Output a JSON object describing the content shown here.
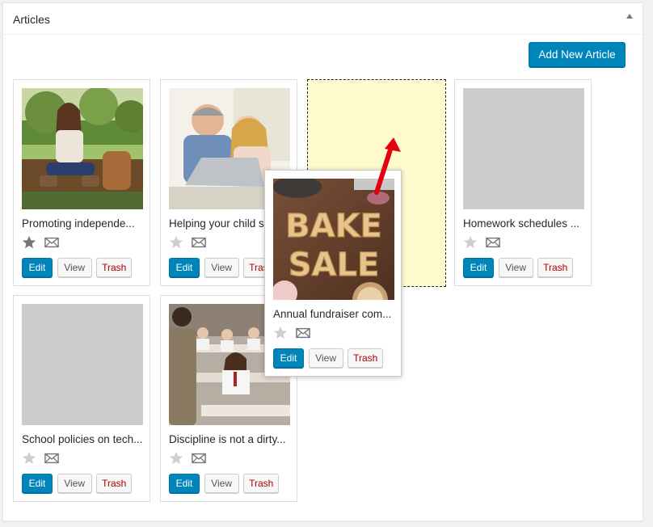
{
  "panel": {
    "title": "Articles",
    "toggle_icon": "arrow-up-icon",
    "add_button_label": "Add New Article"
  },
  "colors": {
    "primary": "#0085ba",
    "trash": "#aa0000",
    "placeholder": "#fffacd",
    "drag_arrow": "#e3000f"
  },
  "cards": [
    {
      "title": "Promoting independe...",
      "featured": true,
      "image": "girl-on-bench-photo",
      "edit": "Edit",
      "view": "View",
      "trash": "Trash"
    },
    {
      "title": "Helping your child s",
      "featured": false,
      "image": "parent-and-child-laptop-photo",
      "edit": "Edit",
      "view": "View",
      "trash": "Trash"
    },
    {
      "title": "Homework schedules ...",
      "featured": false,
      "image": "placeholder-image",
      "edit": "Edit",
      "view": "View",
      "trash": "Trash"
    },
    {
      "title": "School policies on tech...",
      "featured": false,
      "image": "placeholder-image",
      "edit": "Edit",
      "view": "View",
      "trash": "Trash"
    },
    {
      "title": "Discipline is not a dirty...",
      "featured": false,
      "image": "classroom-photo",
      "edit": "Edit",
      "view": "View",
      "trash": "Trash"
    }
  ],
  "dragged_card": {
    "title": "Annual fundraiser com...",
    "featured": false,
    "image": "bake-sale-photo",
    "image_text": [
      "BAKE",
      "SALE"
    ],
    "edit": "Edit",
    "view": "View",
    "trash": "Trash"
  },
  "drop_placeholder": {
    "icon": "drag-direction-arrow-icon"
  }
}
